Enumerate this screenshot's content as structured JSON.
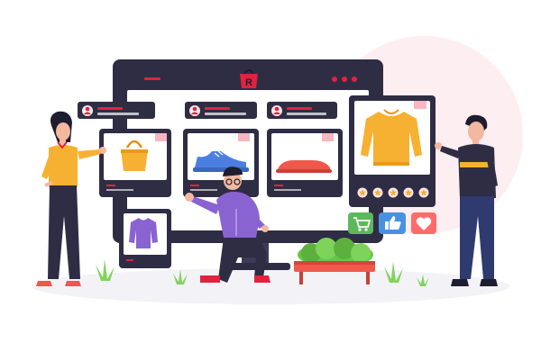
{
  "brand": {
    "logo_letter": "R"
  },
  "colors": {
    "monitor_frame": "#2f2d44",
    "accent_red": "#e0233f",
    "pink_bg": "#fbe6ea",
    "sweater_orange": "#f6b132",
    "sneaker_blue": "#4a7fe0",
    "loafer_red": "#f0584b",
    "purple_shirt": "#8a63d2",
    "plant_green": "#6cc24a",
    "cart_green": "#5cb85c",
    "like_blue": "#4a90e2",
    "heart_red": "#ff6b6b"
  },
  "product_cards": [
    {
      "product": "orange-handbag",
      "icon": "handbag-icon"
    },
    {
      "product": "blue-sneaker",
      "icon": "sneaker-icon"
    },
    {
      "product": "red-loafer",
      "icon": "loafer-icon"
    }
  ],
  "featured_product": {
    "product": "orange-sweater",
    "rating": 5,
    "rating_max": 5
  },
  "small_card": {
    "product": "purple-shirt"
  },
  "action_icons": [
    "add-to-cart-icon",
    "thumbs-up-icon",
    "heart-icon"
  ],
  "window_controls": 3
}
